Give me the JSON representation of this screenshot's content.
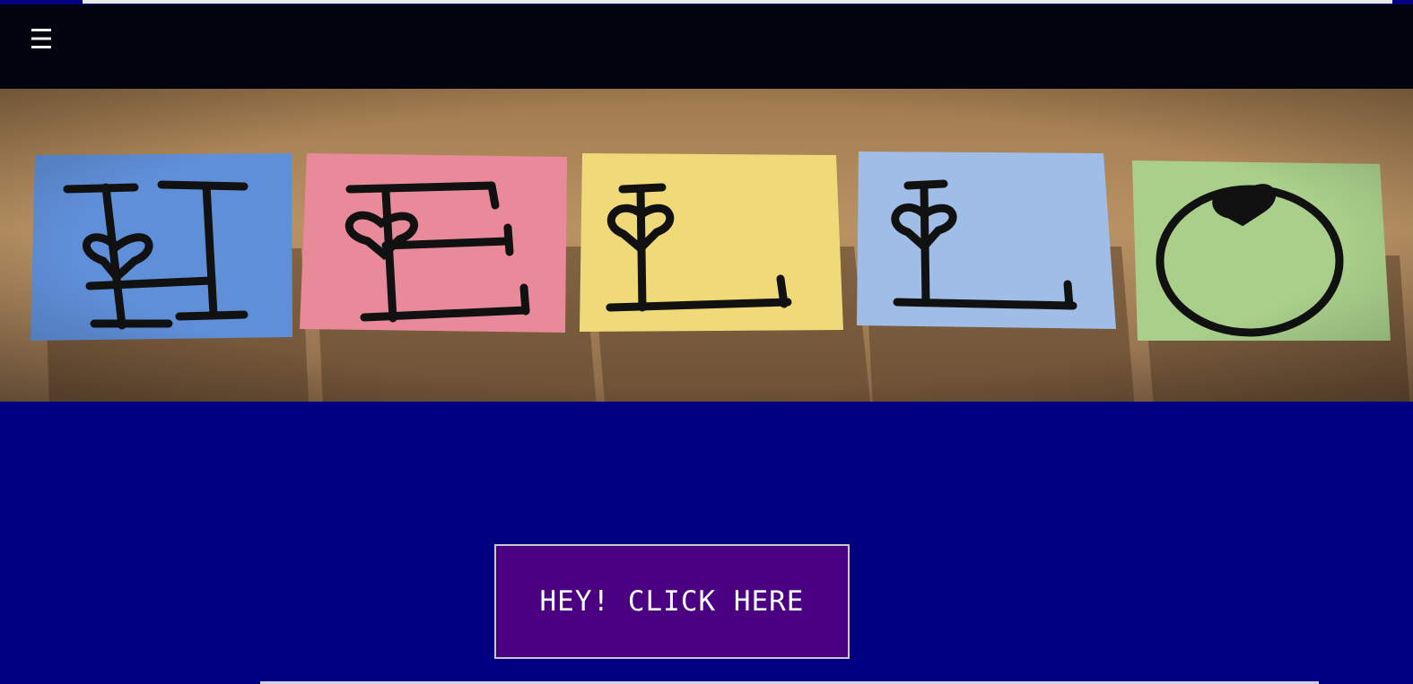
{
  "nav": {
    "menu_icon": "hamburger-menu-icon",
    "menu_glyph": "☰"
  },
  "hero": {
    "image_subject": "sticky notes spelling HELLO",
    "notes": [
      {
        "letter": "H",
        "color": "#5f8fd8"
      },
      {
        "letter": "E",
        "color": "#e88a9a"
      },
      {
        "letter": "L",
        "color": "#efd978"
      },
      {
        "letter": "L",
        "color": "#9fbde6"
      },
      {
        "letter": "O",
        "color": "#a9cf8a"
      }
    ],
    "wall_color": "#b48a5a"
  },
  "main": {
    "button_label": "HEY! CLICK HERE",
    "background": "#000080",
    "button_color": "#4b0082"
  }
}
